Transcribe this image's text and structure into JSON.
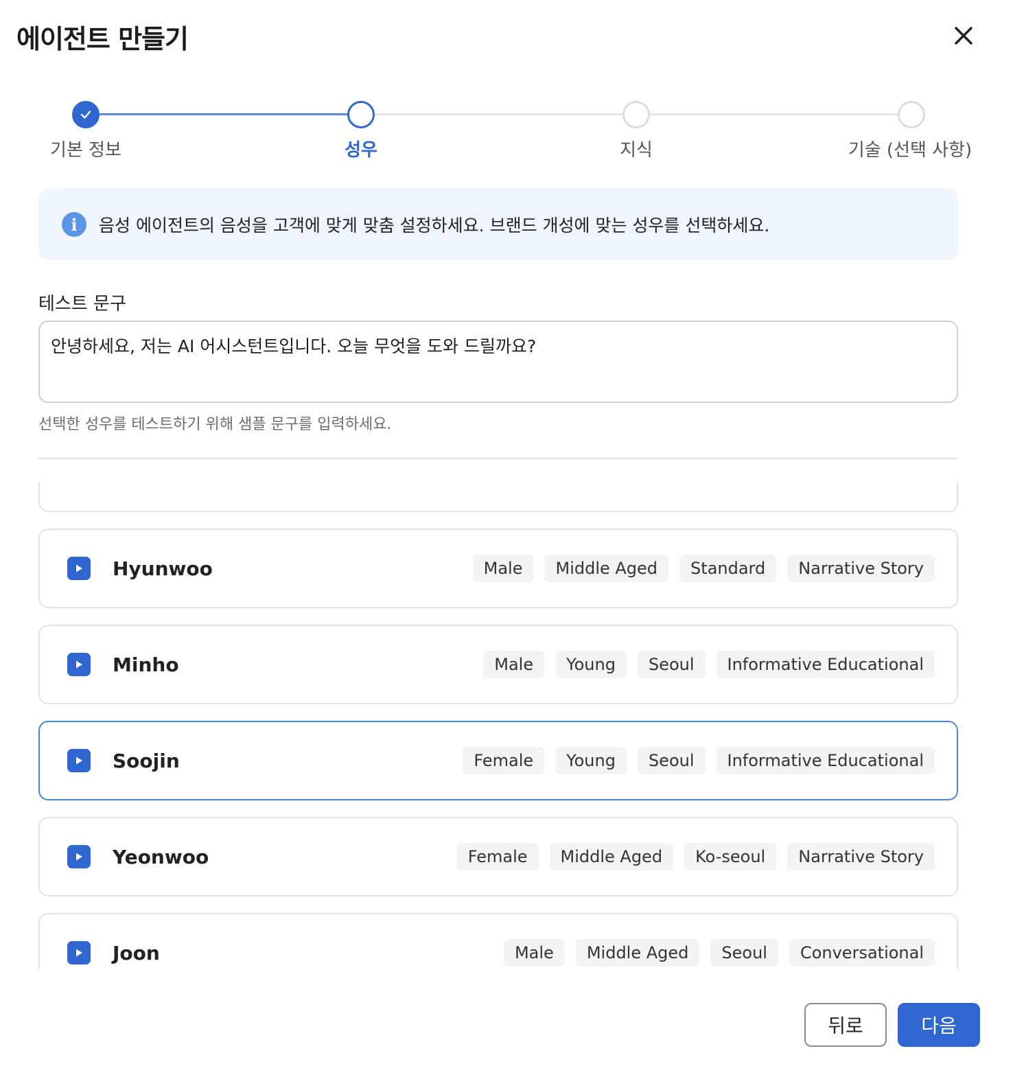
{
  "dialog": {
    "title": "에이전트 만들기",
    "close_icon": "close-icon"
  },
  "stepper": {
    "steps": [
      {
        "label": "기본 정보",
        "state": "done"
      },
      {
        "label": "성우",
        "state": "active"
      },
      {
        "label": "지식",
        "state": "pending"
      },
      {
        "label": "기술 (선택 사항)",
        "state": "pending"
      }
    ]
  },
  "info": {
    "icon": "info-icon",
    "text": "음성 에이전트의 음성을 고객에 맞게 맞춤 설정하세요. 브랜드 개성에 맞는 성우를 선택하세요."
  },
  "test_phrase": {
    "label": "테스트 문구",
    "value": "안녕하세요, 저는 AI 어시스턴트입니다. 오늘 무엇을 도와 드릴까요?",
    "helper": "선택한 성우를 테스트하기 위해 샘플 문구를 입력하세요."
  },
  "voices": [
    {
      "name": "Hyunwoo",
      "tags": [
        "Male",
        "Middle Aged",
        "Standard",
        "Narrative Story"
      ],
      "selected": false
    },
    {
      "name": "Minho",
      "tags": [
        "Male",
        "Young",
        "Seoul",
        "Informative Educational"
      ],
      "selected": false
    },
    {
      "name": "Soojin",
      "tags": [
        "Female",
        "Young",
        "Seoul",
        "Informative Educational"
      ],
      "selected": true
    },
    {
      "name": "Yeonwoo",
      "tags": [
        "Female",
        "Middle Aged",
        "Ko-seoul",
        "Narrative Story"
      ],
      "selected": false
    },
    {
      "name": "Joon",
      "tags": [
        "Male",
        "Middle Aged",
        "Seoul",
        "Conversational"
      ],
      "selected": false
    }
  ],
  "footer": {
    "back_label": "뒤로",
    "next_label": "다음"
  },
  "colors": {
    "accent": "#2f66d0",
    "selected_border": "#4f83d6",
    "info_bg": "#eff5fd"
  }
}
